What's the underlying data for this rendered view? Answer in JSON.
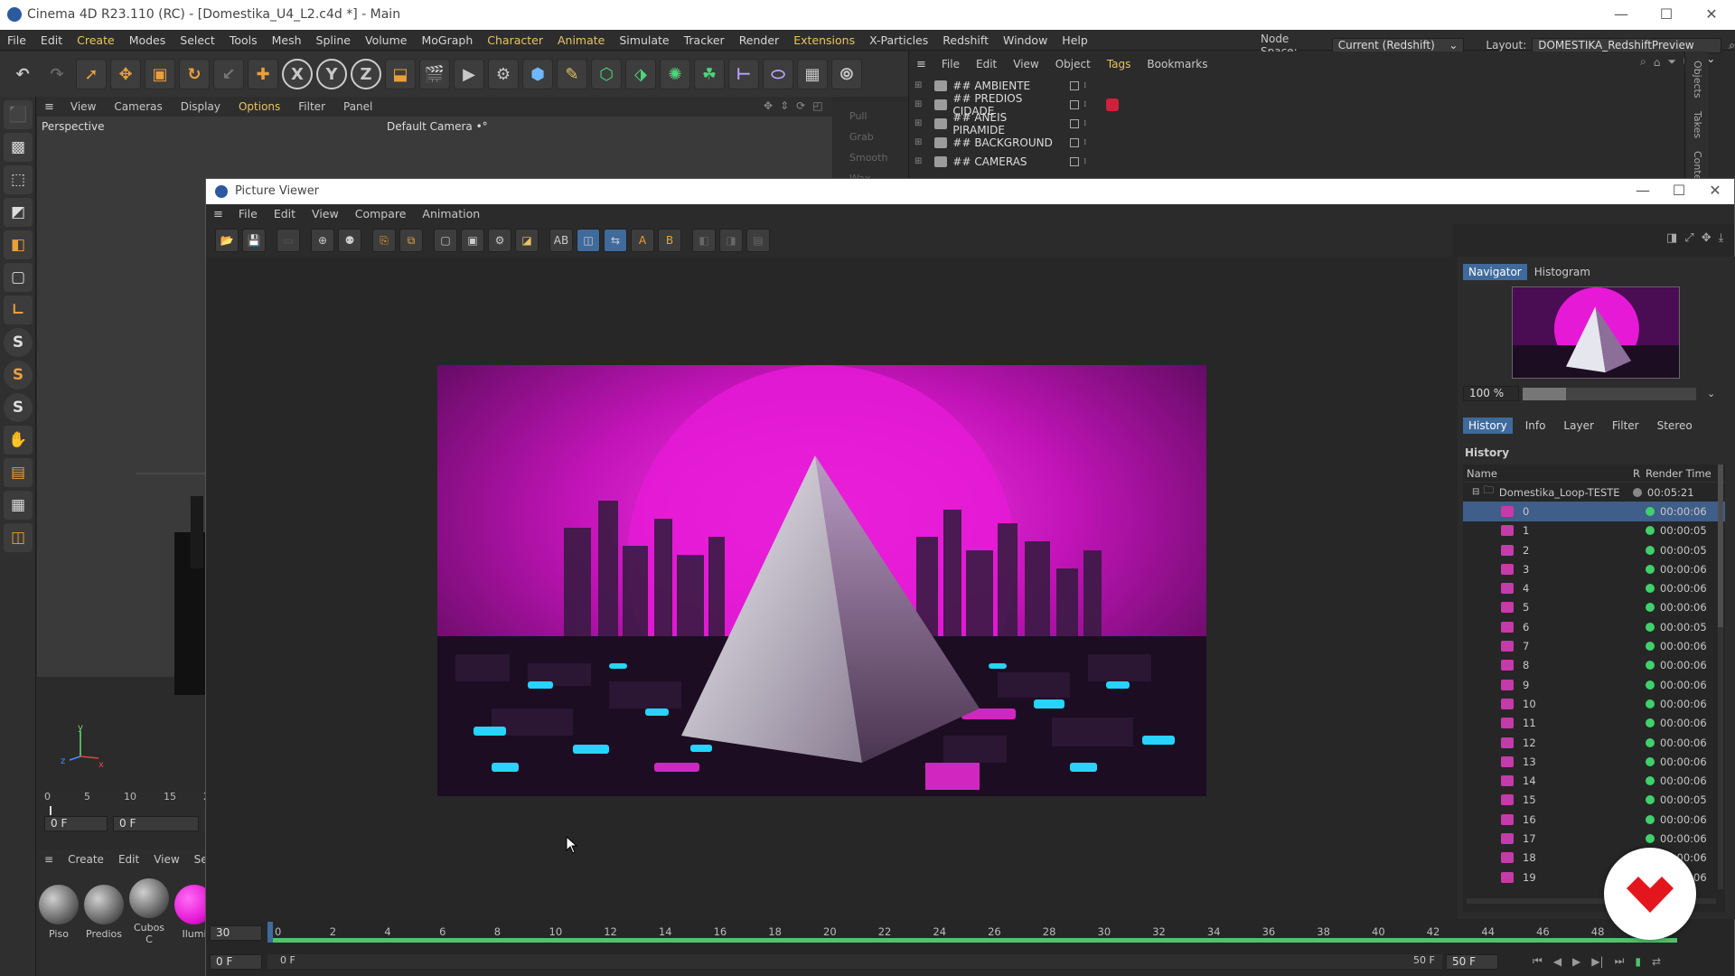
{
  "app": {
    "title": "Cinema 4D R23.110 (RC) - [Domestika_U4_L2.c4d *] - Main",
    "minimize": "—",
    "maximize": "☐",
    "close": "✕"
  },
  "menubar": {
    "items": [
      "File",
      "Edit",
      "Create",
      "Modes",
      "Select",
      "Tools",
      "Mesh",
      "Spline",
      "Volume",
      "MoGraph",
      "Character",
      "Animate",
      "Simulate",
      "Tracker",
      "Render",
      "Extensions",
      "X-Particles",
      "Redshift",
      "Window",
      "Help"
    ],
    "node_space_label": "Node Space:",
    "node_space_value": "Current (Redshift)",
    "layout_label": "Layout:",
    "layout_value": "DOMESTIKA_RedshiftPreview (User)"
  },
  "toolbar": {
    "axis_x": "X",
    "axis_y": "Y",
    "axis_z": "Z"
  },
  "viewport": {
    "menu": [
      "View",
      "Cameras",
      "Display",
      "Options",
      "Filter",
      "Panel"
    ],
    "name": "Perspective",
    "camera": "Default Camera",
    "camera_marks": "•°",
    "sculpt_tools": [
      "Pull",
      "Grab",
      "Smooth",
      "Wax"
    ],
    "axis_x": "x",
    "axis_y": "y",
    "axis_z": "z"
  },
  "left_palette": {
    "s1": "S",
    "s2": "S",
    "s3": "S"
  },
  "left_timeline": {
    "ticks": [
      "0",
      "5",
      "10",
      "15",
      "2"
    ],
    "start_field": "0 F",
    "end_field": "0 F"
  },
  "materials": {
    "menu": [
      "Create",
      "Edit",
      "View",
      "Select"
    ],
    "items": [
      "Piso",
      "Predios",
      "Cubos C",
      "Ilumi"
    ]
  },
  "object_manager": {
    "menu": [
      "File",
      "Edit",
      "View",
      "Object",
      "Tags",
      "Bookmarks"
    ],
    "objects": [
      "## AMBIENTE",
      "## PREDIOS CIDADE",
      "## ANEIS PIRAMIDE",
      "## BACKGROUND",
      "## CAMERAS"
    ],
    "side_tabs": [
      "Objects",
      "Takes",
      "Conte"
    ]
  },
  "picture_viewer": {
    "title": "Picture Viewer",
    "menu": [
      "File",
      "Edit",
      "View",
      "Compare",
      "Animation"
    ],
    "tool_a": "A",
    "tool_b": "B",
    "panel_tabs": [
      "Navigator",
      "Histogram"
    ],
    "zoom": "100 %",
    "info_tabs": [
      "History",
      "Info",
      "Layer",
      "Filter",
      "Stereo"
    ],
    "history_label": "History",
    "col_name": "Name",
    "col_r": "R",
    "col_time": "Render Time",
    "folder_name": "Domestika_Loop-TESTE",
    "folder_time": "00:05:21",
    "frames": [
      {
        "n": "0",
        "t": "00:00:06"
      },
      {
        "n": "1",
        "t": "00:00:05"
      },
      {
        "n": "2",
        "t": "00:00:05"
      },
      {
        "n": "3",
        "t": "00:00:06"
      },
      {
        "n": "4",
        "t": "00:00:06"
      },
      {
        "n": "5",
        "t": "00:00:06"
      },
      {
        "n": "6",
        "t": "00:00:05"
      },
      {
        "n": "7",
        "t": "00:00:06"
      },
      {
        "n": "8",
        "t": "00:00:06"
      },
      {
        "n": "9",
        "t": "00:00:06"
      },
      {
        "n": "10",
        "t": "00:00:06"
      },
      {
        "n": "11",
        "t": "00:00:06"
      },
      {
        "n": "12",
        "t": "00:00:06"
      },
      {
        "n": "13",
        "t": "00:00:06"
      },
      {
        "n": "14",
        "t": "00:00:06"
      },
      {
        "n": "15",
        "t": "00:00:05"
      },
      {
        "n": "16",
        "t": "00:00:06"
      },
      {
        "n": "17",
        "t": "00:00:06"
      },
      {
        "n": "18",
        "t": "00:00:06"
      },
      {
        "n": "19",
        "t": "00:00:06"
      }
    ],
    "timeline": {
      "fps": "30",
      "ticks": [
        "0",
        "2",
        "4",
        "6",
        "8",
        "10",
        "12",
        "14",
        "16",
        "18",
        "20",
        "22",
        "24",
        "26",
        "28",
        "30",
        "32",
        "34",
        "36",
        "38",
        "40",
        "42",
        "44",
        "46",
        "48"
      ],
      "end_tick": "0 F",
      "current_frame": "0 F",
      "start_field": "0 F",
      "end_frame": "50 F",
      "end_field": "50 F"
    }
  },
  "colors": {
    "accent": "#3f6a9c",
    "magenta": "#e61ad6",
    "cyan": "#26d4ff",
    "green": "#3fd16b",
    "highlight_menu": "#e9c463"
  }
}
